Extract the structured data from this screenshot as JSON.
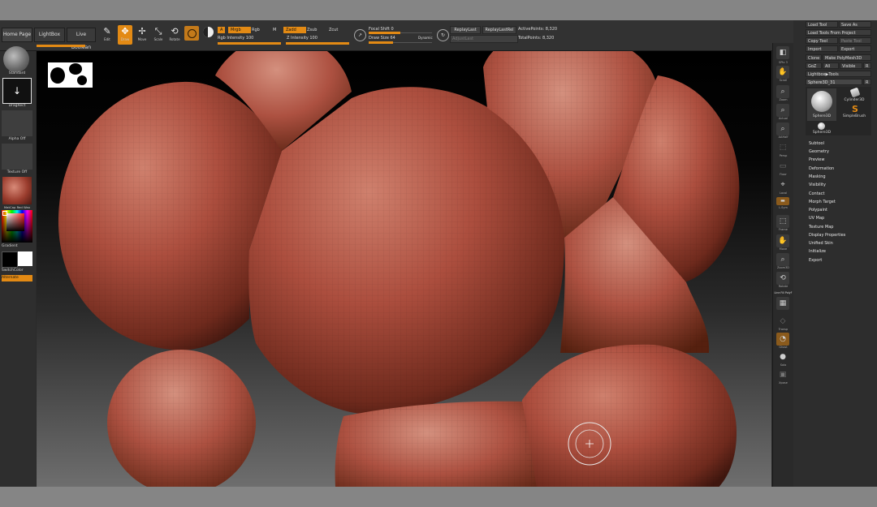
{
  "topbar": {
    "tabs": [
      "Home Page",
      "LightBox",
      "Live Boolean"
    ],
    "tools": [
      {
        "label": "Edit",
        "icon": "edit-icon"
      },
      {
        "label": "Draw",
        "icon": "draw-icon"
      },
      {
        "label": "Move",
        "icon": "move-icon"
      },
      {
        "label": "Scale",
        "icon": "scale-icon"
      },
      {
        "label": "Rotate",
        "icon": "rotate-icon"
      }
    ],
    "mode_a": "A",
    "mrgb": "Mrgb",
    "rgb": "Rgb",
    "m": "M",
    "rgb_intensity": "Rgb Intensity 100",
    "rgb_intensity_level": 1.0,
    "zadd": "Zadd",
    "zsub": "Zsub",
    "zcut": "Zcut",
    "z_intensity": "Z Intensity 100",
    "z_intensity_level": 1.0,
    "focal_shift": "Focal Shift 0",
    "focal_shift_level": 0.5,
    "draw_size": "Draw Size 64",
    "draw_size_level": 0.38,
    "dynamic": "Dynamic",
    "replay_last": "ReplayLast",
    "replay_last_rel": "ReplayLastRel",
    "adjust_last": "AdjustLast",
    "active_points": "ActivePoints: 8,320",
    "total_points": "TotalPoints: 8,320"
  },
  "left": {
    "brush": "Standard",
    "stroke": "DragRect",
    "alpha": "Alpha Off",
    "texture": "Texture Off",
    "material": "MatCap Red Wax",
    "gradient": "Gradient",
    "switch_color": "SwitchColor",
    "alternate": "Alternate"
  },
  "right_shelf": [
    "SPix 3",
    "Scroll",
    "Zoom",
    "Actual",
    "AAHalf",
    "Persp",
    "Floor",
    "Local",
    "L.Sym",
    "Frame",
    "Move",
    "Zoom3D",
    "Rotate",
    "Line Fill PolyF",
    "Transp",
    "Ghost",
    "Solo",
    "Xpose"
  ],
  "palette": {
    "load_tool": "Load Tool",
    "save_as": "Save As",
    "load_from_project": "Load Tools From Project",
    "copy_tool": "Copy Tool",
    "paste_tool": "Paste Tool",
    "import": "Import",
    "export": "Export",
    "clone": "Clone",
    "make_polymesh": "Make PolyMesh3D",
    "goz": "GoZ",
    "all": "All",
    "visible": "Visible",
    "r": "R",
    "lightbox_tools": "Lightbox▶Tools",
    "current_tool": "Sphere3D_31",
    "tool_count": "R",
    "thumbs": [
      "Sphere3D",
      "Cylinder3D",
      "SimpleBrush",
      "Sphere3D"
    ],
    "menu": [
      "Subtool",
      "Geometry",
      "Preview",
      "Deformation",
      "Masking",
      "Visibility",
      "Contact",
      "Morph Target",
      "Polypaint",
      "UV Map",
      "Texture Map",
      "Display Properties",
      "Unified Skin",
      "Initialize",
      "Export"
    ]
  }
}
